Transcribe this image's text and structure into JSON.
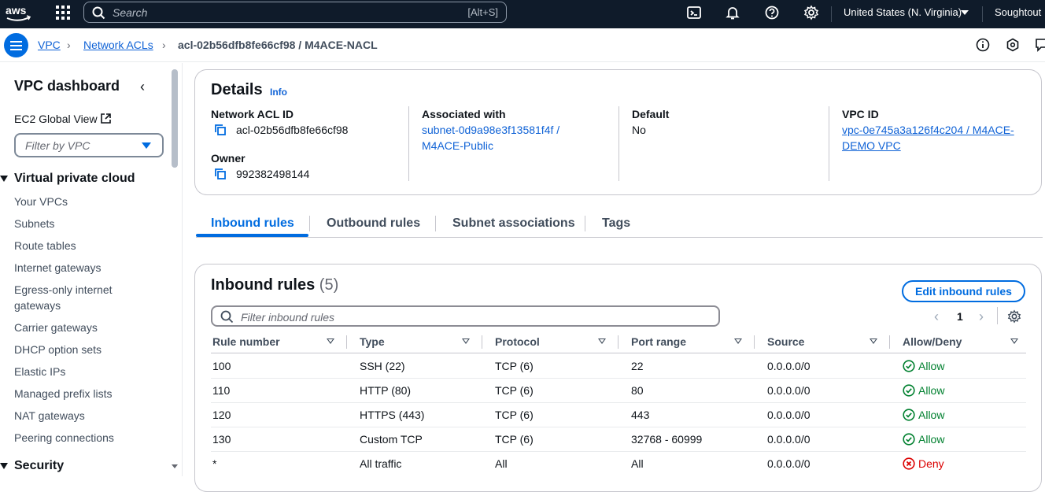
{
  "topnav": {
    "logo": "aws",
    "search_placeholder": "Search",
    "search_shortcut": "[Alt+S]",
    "region": "United States (N. Virginia)",
    "user": "Soughtout"
  },
  "breadcrumb": {
    "items": [
      "VPC",
      "Network ACLs"
    ],
    "current": "acl-02b56dfb8fe66cf98 / M4ACE-NACL"
  },
  "sidebar": {
    "title": "VPC dashboard",
    "global_view": "EC2 Global View",
    "filter_placeholder": "Filter by VPC",
    "section_vpc": "Virtual private cloud",
    "items": [
      "Your VPCs",
      "Subnets",
      "Route tables",
      "Internet gateways",
      "Egress-only internet gateways",
      "Carrier gateways",
      "DHCP option sets",
      "Elastic IPs",
      "Managed prefix lists",
      "NAT gateways",
      "Peering connections"
    ],
    "section_security": "Security"
  },
  "details": {
    "title": "Details",
    "info": "Info",
    "nacl_id_label": "Network ACL ID",
    "nacl_id": "acl-02b56dfb8fe66cf98",
    "owner_label": "Owner",
    "owner": "992382498144",
    "associated_label": "Associated with",
    "associated_line1": "subnet-0d9a98e3f13581f4f /",
    "associated_line2": "M4ACE-Public",
    "default_label": "Default",
    "default_value": "No",
    "vpc_label": "VPC ID",
    "vpc_line1": "vpc-0e745a3a126f4c204 / M4ACE-",
    "vpc_line2": "DEMO VPC"
  },
  "tabs": [
    "Inbound rules",
    "Outbound rules",
    "Subnet associations",
    "Tags"
  ],
  "rules": {
    "title": "Inbound rules",
    "count": "(5)",
    "edit_button": "Edit inbound rules",
    "filter_placeholder": "Filter inbound rules",
    "page": "1",
    "columns": [
      "Rule number",
      "Type",
      "Protocol",
      "Port range",
      "Source",
      "Allow/Deny"
    ],
    "rows": [
      {
        "rule": "100",
        "type": "SSH (22)",
        "protocol": "TCP (6)",
        "port": "22",
        "source": "0.0.0.0/0",
        "action": "Allow"
      },
      {
        "rule": "110",
        "type": "HTTP (80)",
        "protocol": "TCP (6)",
        "port": "80",
        "source": "0.0.0.0/0",
        "action": "Allow"
      },
      {
        "rule": "120",
        "type": "HTTPS (443)",
        "protocol": "TCP (6)",
        "port": "443",
        "source": "0.0.0.0/0",
        "action": "Allow"
      },
      {
        "rule": "130",
        "type": "Custom TCP",
        "protocol": "TCP (6)",
        "port": "32768 - 60999",
        "source": "0.0.0.0/0",
        "action": "Allow"
      },
      {
        "rule": "*",
        "type": "All traffic",
        "protocol": "All",
        "port": "All",
        "source": "0.0.0.0/0",
        "action": "Deny"
      }
    ]
  },
  "colors": {
    "accent": "#006ce0",
    "allow": "#00802f",
    "deny": "#db0000",
    "nav": "#0f1b2a"
  }
}
